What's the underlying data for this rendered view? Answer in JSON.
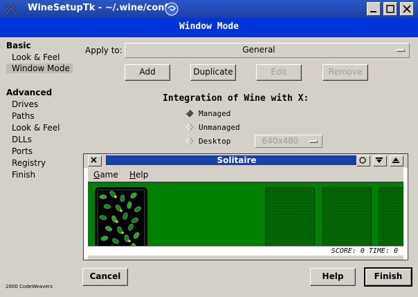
{
  "window": {
    "title": "WineSetupTk - ~/.wine/config",
    "icons": [
      "wine-x-icon",
      "desktop-swirl-icon",
      "minimize-icon",
      "maximize-icon",
      "close-icon"
    ]
  },
  "header": {
    "title": "Window Mode"
  },
  "sidebar": {
    "basic_heading": "Basic",
    "basic_items": [
      "Look & Feel",
      "Window Mode"
    ],
    "selected": "Window Mode",
    "advanced_heading": "Advanced",
    "advanced_items": [
      "Drives",
      "Paths",
      "Look & Feel",
      "DLLs",
      "Ports",
      "Registry",
      "Finish"
    ],
    "credit": "2000 CodeWeavers"
  },
  "apply": {
    "label": "Apply to:",
    "value": "General"
  },
  "actions": {
    "add": "Add",
    "duplicate": "Duplicate",
    "edit": "Edit",
    "remove": "Remove"
  },
  "integration": {
    "heading": "Integration of Wine with X:",
    "options": [
      "Managed",
      "Unmanaged",
      "Desktop"
    ],
    "selected": "Managed",
    "desktop_size": "640x480"
  },
  "solitaire": {
    "title": "Solitaire",
    "menu": [
      {
        "accel": "G",
        "rest": "ame"
      },
      {
        "accel": "H",
        "rest": "elp"
      }
    ],
    "score_text": "SCORE: 0 TIME: 0",
    "felt_color": "#008000"
  },
  "footer": {
    "cancel": "Cancel",
    "help": "Help",
    "finish": "Finish"
  },
  "colors": {
    "header_blue": "#0033d8",
    "title_blue": "#1b3fa6",
    "face": "#d4d0c8"
  }
}
